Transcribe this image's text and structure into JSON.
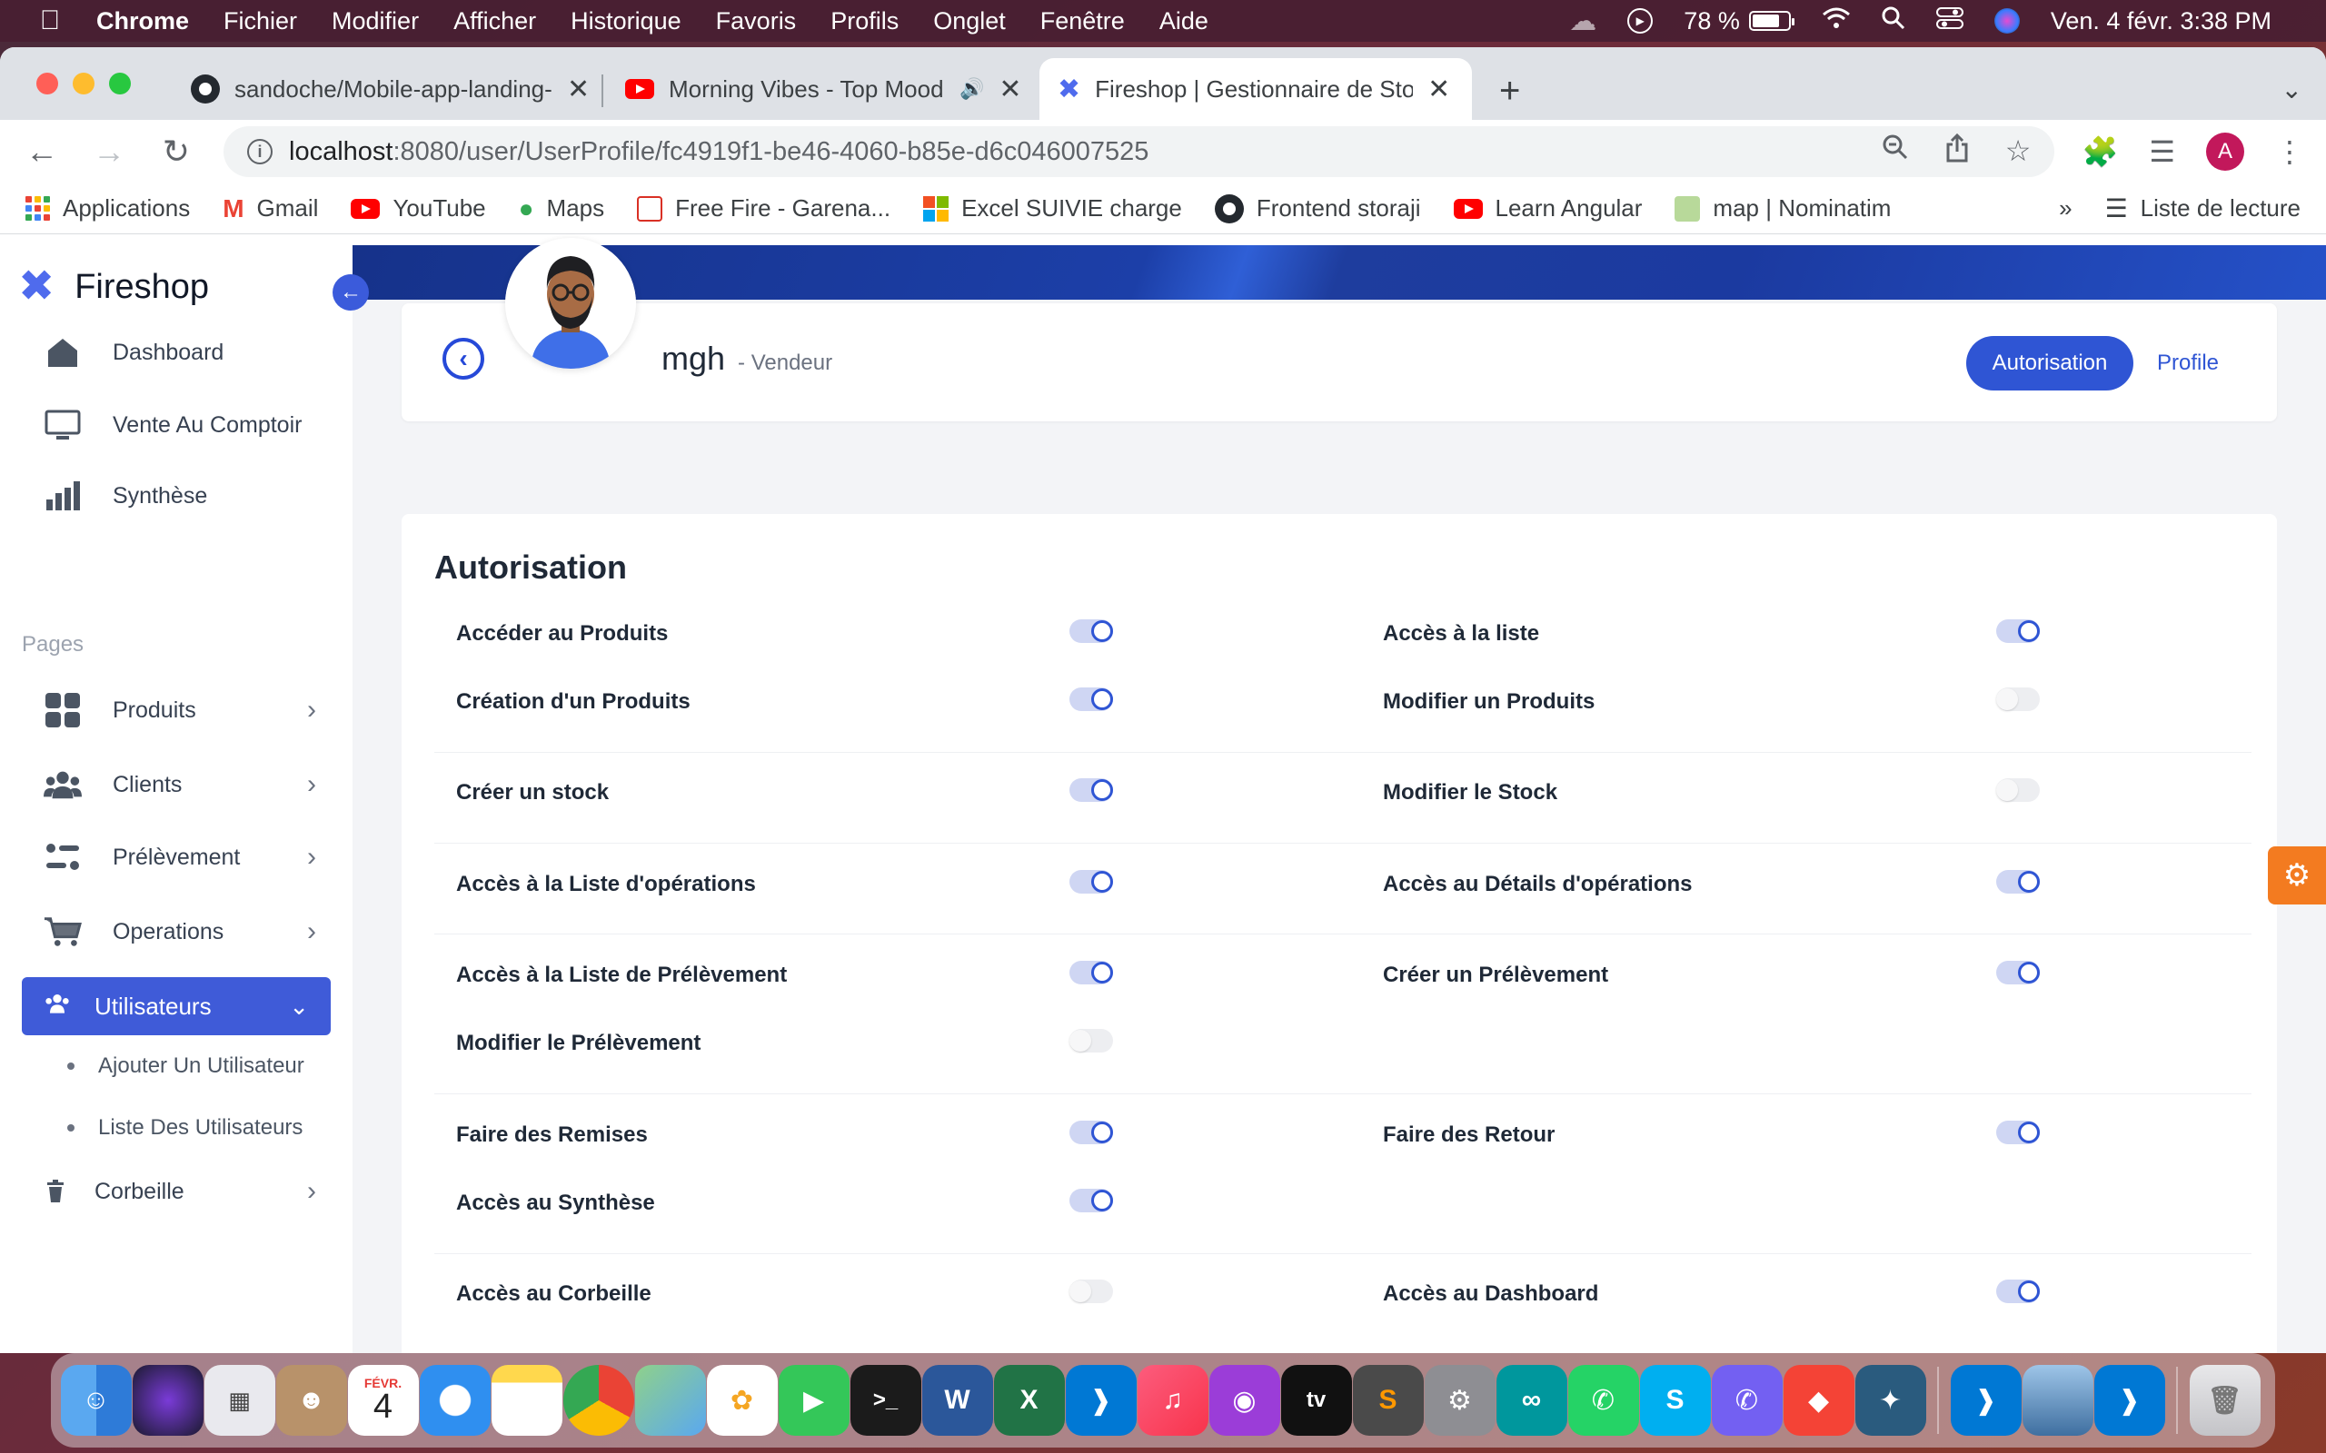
{
  "menubar": {
    "app": "Chrome",
    "items": [
      "Fichier",
      "Modifier",
      "Afficher",
      "Historique",
      "Favoris",
      "Profils",
      "Onglet",
      "Fenêtre",
      "Aide"
    ],
    "battery": "78 %",
    "datetime": "Ven. 4 févr.  3:38 PM"
  },
  "tabs": [
    {
      "title": "sandoche/Mobile-app-landing-page",
      "favicon": "github-icon"
    },
    {
      "title": "Morning Vibes - Top Mood",
      "favicon": "youtube-icon"
    },
    {
      "title": "Fireshop | Gestionnaire de Stock",
      "favicon": "fireshop-icon"
    }
  ],
  "address": {
    "host": "localhost",
    "path": ":8080/user/UserProfile/fc4919f1-be46-4060-b85e-d6c046007525"
  },
  "profile_initial": "A",
  "bookmarks": [
    {
      "label": "Applications",
      "icon": "apps-grid-icon"
    },
    {
      "label": "Gmail",
      "icon": "gmail-icon"
    },
    {
      "label": "YouTube",
      "icon": "youtube-icon"
    },
    {
      "label": "Maps",
      "icon": "maps-icon"
    },
    {
      "label": "Free Fire - Garena...",
      "icon": "freefire-icon"
    },
    {
      "label": "Excel SUIVIE charge",
      "icon": "microsoft-icon"
    },
    {
      "label": "Frontend storaji",
      "icon": "github-icon"
    },
    {
      "label": "Learn Angular",
      "icon": "youtube-icon"
    },
    {
      "label": "map | Nominatim",
      "icon": "map-icon"
    }
  ],
  "reading_list": "Liste de lecture",
  "sidebar": {
    "brand": "Fireshop",
    "top_items": [
      "Dashboard",
      "Vente Au Comptoir",
      "Synthèse"
    ],
    "section": "Pages",
    "menu": [
      "Produits",
      "Clients",
      "Prélèvement",
      "Operations"
    ],
    "active": "Utilisateurs",
    "sub_items": [
      "Ajouter Un Utilisateur",
      "Liste Des Utilisateurs"
    ],
    "trash": "Corbeille"
  },
  "profile": {
    "name": "mgh",
    "role": "- Vendeur",
    "btn_auth": "Autorisation",
    "btn_profile": "Profile"
  },
  "autorisation": {
    "title": "Autorisation",
    "permissions": [
      {
        "label": "Accéder au Produits",
        "on": true
      },
      {
        "label": "Accès à la liste",
        "on": true
      },
      {
        "label": "Création d'un Produits",
        "on": true
      },
      {
        "label": "Modifier un Produits",
        "on": false
      },
      {
        "label": "Créer un stock",
        "on": true
      },
      {
        "label": "Modifier le Stock",
        "on": false
      },
      {
        "label": "Accès à la Liste d'opérations",
        "on": true
      },
      {
        "label": "Accès au Détails d'opérations",
        "on": true
      },
      {
        "label": "Accès à la Liste de Prélèvement",
        "on": true
      },
      {
        "label": "Créer un Prélèvement",
        "on": true
      },
      {
        "label": "Modifier le Prélèvement",
        "on": false
      },
      {
        "label": "Faire des Remises",
        "on": true
      },
      {
        "label": "Faire des Retour",
        "on": true
      },
      {
        "label": "Accès au Synthèse",
        "on": true
      },
      {
        "label": "Accès au Corbeille",
        "on": false
      },
      {
        "label": "Accès au Dashboard",
        "on": true
      }
    ]
  },
  "dock": {
    "calendar_month": "FÉVR.",
    "calendar_day": "4"
  },
  "colors": {
    "accent": "#2f55d4",
    "sidebar_active": "#3f5bd8",
    "gear_tab": "#f37b20"
  }
}
